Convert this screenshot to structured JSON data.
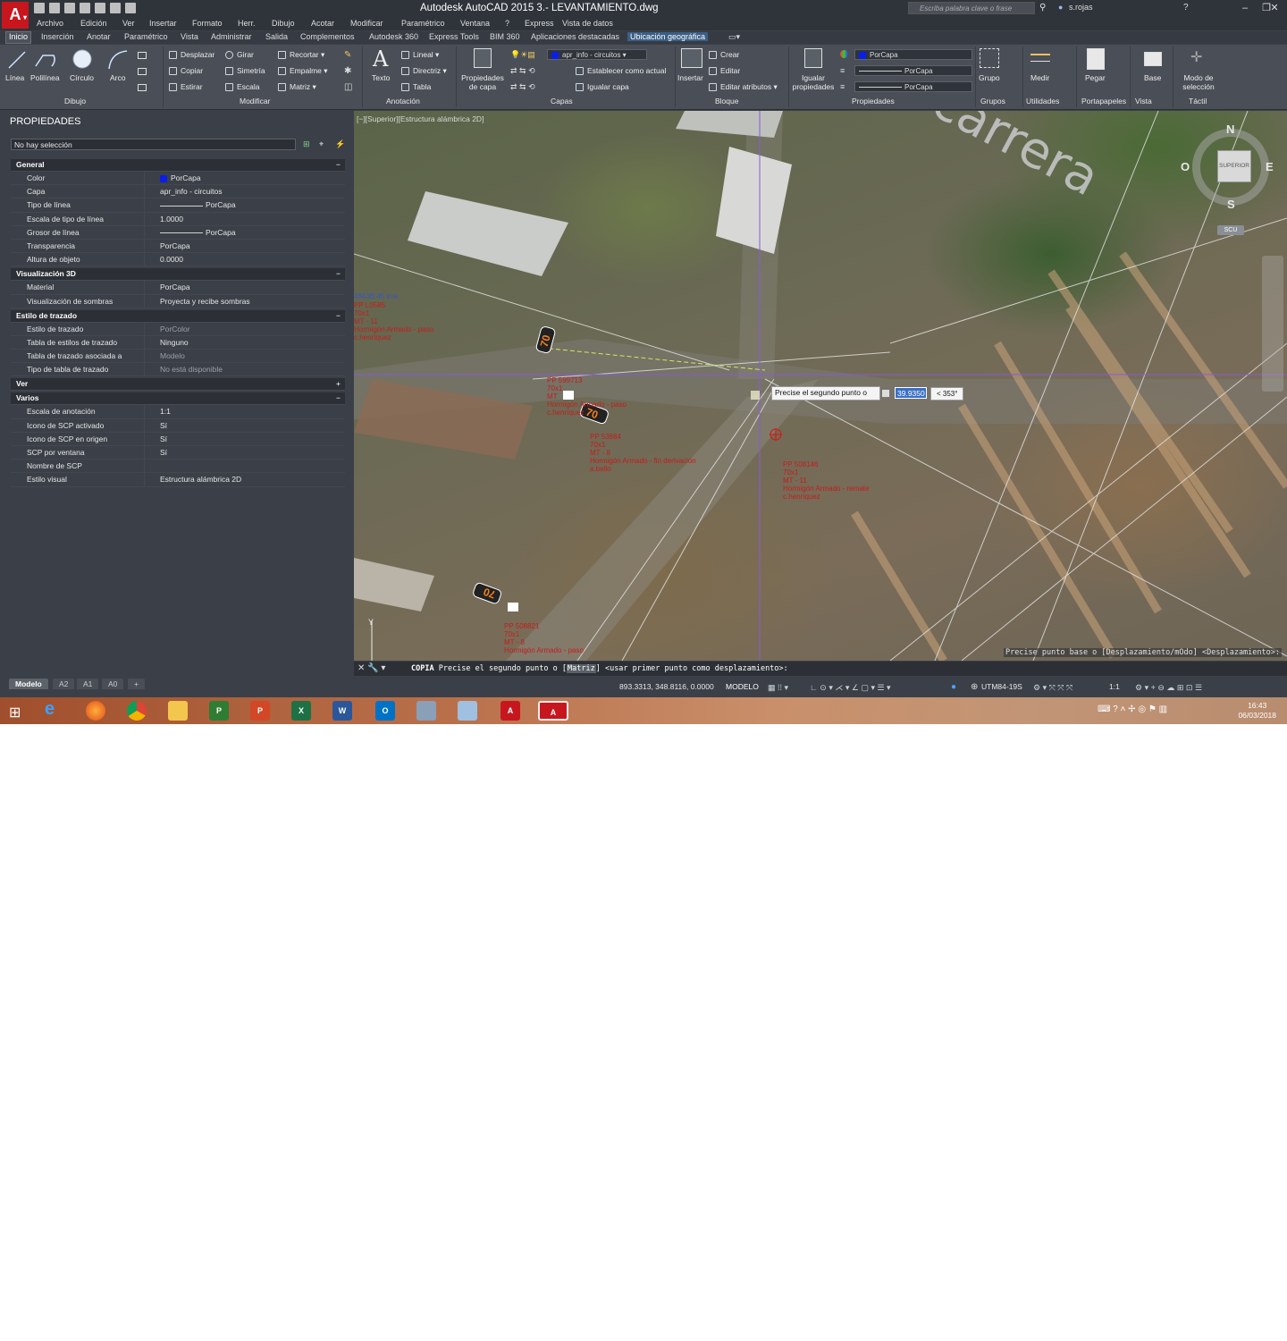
{
  "window": {
    "title": "Autodesk AutoCAD 2015    3.- LEVANTAMIENTO.dwg",
    "search_placeholder": "Escriba palabra clave o frase",
    "user": "s.rojas",
    "help": "?"
  },
  "menubar": [
    "Archivo",
    "Edición",
    "Ver",
    "Insertar",
    "Formato",
    "Herr.",
    "Dibujo",
    "Acotar",
    "Modificar",
    "Paramétrico",
    "Ventana",
    "?",
    "Express",
    "Vista de datos"
  ],
  "ribbon_tabs": [
    "Inicio",
    "Inserción",
    "Anotar",
    "Paramétrico",
    "Vista",
    "Administrar",
    "Salida",
    "Complementos",
    "Autodesk 360",
    "Express Tools",
    "BIM 360",
    "Aplicaciones destacadas",
    "Ubicación geográfica"
  ],
  "ribbon": {
    "draw": {
      "linea": "Línea",
      "polilinea": "Polilínea",
      "circulo": "Círculo",
      "arco": "Arco",
      "label": "Dibujo"
    },
    "modify": {
      "desplazar": "Desplazar",
      "girar": "Girar",
      "recortar": "Recortar",
      "copiar": "Copiar",
      "simetria": "Simetría",
      "empalme": "Empalme",
      "estirar": "Estirar",
      "escala": "Escala",
      "matriz": "Matriz",
      "label": "Modificar"
    },
    "annotation": {
      "texto": "Texto",
      "lineal": "Lineal",
      "directriz": "Directriz",
      "tabla": "Tabla",
      "label": "Anotación"
    },
    "layers": {
      "props": "Propiedades de capa",
      "layer": "apr_info - circuitos",
      "set_current": "Establecer como actual",
      "match": "Igualar capa",
      "label": "Capas"
    },
    "block": {
      "insertar": "Insertar",
      "crear": "Crear",
      "editar": "Editar",
      "editar_attr": "Editar atributos",
      "label": "Bloque"
    },
    "properties": {
      "match": "Igualar propiedades",
      "color": "PorCapa",
      "linetype": "PorCapa",
      "lineweight": "PorCapa",
      "label": "Propiedades"
    },
    "groups": {
      "grupo": "Grupo",
      "label": "Grupos"
    },
    "utilities": {
      "medir": "Medir",
      "label": "Utilidades"
    },
    "clipboard": {
      "pegar": "Pegar",
      "label": "Portapapeles"
    },
    "view": {
      "base": "Base",
      "label": "Vista"
    },
    "touch": {
      "modo": "Modo de selección",
      "label": "Táctil"
    }
  },
  "properties_palette": {
    "title": "PROPIEDADES",
    "selection": "No hay selección",
    "categories": [
      {
        "name": "General",
        "toggle": "−",
        "rows": [
          {
            "k": "Color",
            "v": "PorCapa",
            "swatch": "#0a1fe6"
          },
          {
            "k": "Capa",
            "v": "apr_info - circuitos"
          },
          {
            "k": "Tipo de línea",
            "v": "PorCapa",
            "line": true
          },
          {
            "k": "Escala de tipo de línea",
            "v": "1.0000"
          },
          {
            "k": "Grosor de línea",
            "v": "PorCapa",
            "line": true
          },
          {
            "k": "Transparencia",
            "v": "PorCapa"
          },
          {
            "k": "Altura de objeto",
            "v": "0.0000"
          }
        ]
      },
      {
        "name": "Visualización 3D",
        "toggle": "−",
        "rows": [
          {
            "k": "Material",
            "v": "PorCapa"
          },
          {
            "k": "Visualización de sombras",
            "v": "Proyecta y recibe sombras"
          }
        ]
      },
      {
        "name": "Estilo de trazado",
        "toggle": "−",
        "rows": [
          {
            "k": "Estilo de trazado",
            "v": "PorColor",
            "dim": true
          },
          {
            "k": "Tabla de estilos de trazado",
            "v": "Ninguno"
          },
          {
            "k": "Tabla de trazado asociada a",
            "v": "Modelo",
            "dim": true
          },
          {
            "k": "Tipo de tabla de trazado",
            "v": "No está disponible",
            "dim": true
          }
        ]
      },
      {
        "name": "Ver",
        "toggle": "+",
        "rows": []
      },
      {
        "name": "Varios",
        "toggle": "−",
        "rows": [
          {
            "k": "Escala de anotación",
            "v": "1:1"
          },
          {
            "k": "Icono de SCP activado",
            "v": "Sí"
          },
          {
            "k": "Icono de SCP en origen",
            "v": "Sí"
          },
          {
            "k": "SCP por ventana",
            "v": "Sí"
          },
          {
            "k": "Nombre de SCP",
            "v": ""
          },
          {
            "k": "Estilo visual",
            "v": "Estructura alámbrica 2D"
          }
        ]
      }
    ]
  },
  "viewport": {
    "label": "[−][Superior][Estructura alámbrica 2D]",
    "street_name": "carrera",
    "viewcube": {
      "n": "N",
      "s": "S",
      "e": "E",
      "w": "O",
      "top": "SUPERIOR",
      "ucs": "SCU"
    },
    "dyn_prompt": "Precise el segundo punto o",
    "dyn_value": "39.9350",
    "dyn_angle": "< 353°",
    "command_hint": "Precise punto base o [Desplazamiento/mOdo] <Desplazamiento>:",
    "annotations": [
      "PP 599713\n70x1\nMT\nHormigón Armado - paso\nc.henríquez",
      "PP 53884\n70x1\nMT - 8\nHormigón Armado - fin derivación\na.bello",
      "PP 508146\n70x1\nMT - 11\nHormigón Armado - remate\nc.henríquez",
      "PP 508821\n70x1\nMT - 8\nHormigón Armado - paso",
      "PP L0585\n70x1\nMT - 11\nHormigón Armado - paso\nc.henríquez"
    ],
    "annotation_blue": "4843B.45 kva"
  },
  "command_line": {
    "cmd": "COPIA",
    "text_before": " Precise el segundo punto o [",
    "option": "Matriz",
    "text_after": "] <usar primer punto como desplazamiento>:"
  },
  "layout_tabs": [
    "Modelo",
    "A2",
    "A1",
    "A0",
    "+"
  ],
  "status": {
    "coords": "893.3313, 348.8116, 0.0000",
    "mode": "MODELO",
    "utm": "UTM84-19S",
    "scale": "1:1"
  },
  "taskbar": {
    "time": "16:43",
    "date": "06/03/2018"
  },
  "colors": {
    "accent_red": "#c8161e",
    "annotation_red": "#c51d1d",
    "layer_blue": "#0a1fe6"
  }
}
